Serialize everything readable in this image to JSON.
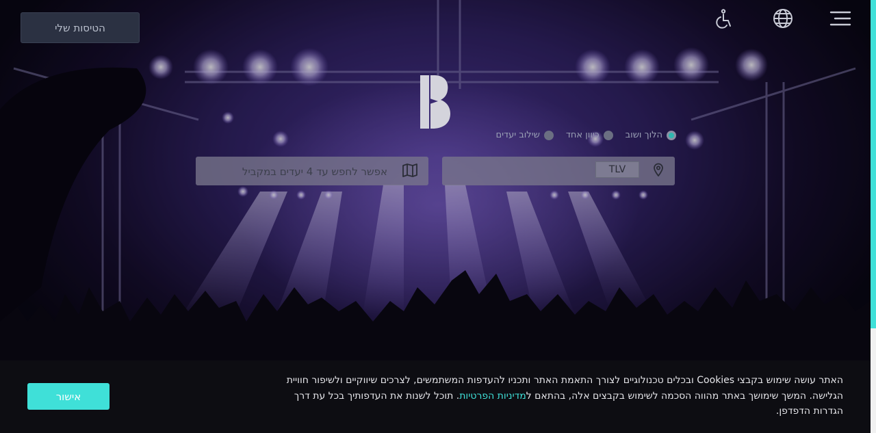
{
  "header": {
    "trips_button_label": "הטיסות שלי",
    "icons": [
      "menu-icon",
      "globe-icon",
      "accessibility-icon"
    ]
  },
  "logo": {
    "letter": "B"
  },
  "trip_types": [
    {
      "label": "הלוך ושוב",
      "selected": true
    },
    {
      "label": "כיוון אחד",
      "selected": false
    },
    {
      "label": "שילוב יעדים",
      "selected": false
    }
  ],
  "search": {
    "origin_value": "TLV",
    "destination_placeholder": "אפשר לחפש עד 4 יעדים במקביל"
  },
  "cookie_banner": {
    "text_before_link": "האתר עושה שימוש בקבצי Cookies ובכלים טכנולוגיים לצורך התאמת האתר ותכניו להעדפות המשתמשים, לצרכים שיווקיים ולשיפור חוויית הגלישה. המשך שימושך באתר מהווה הסכמה לשימוש בקבצים אלה, בהתאם ל",
    "link_text": "מדיניות הפרטיות",
    "text_after_link": ". תוכל לשנות את העדפותיך בכל עת דרך הגדרות הדפדפן.",
    "accept_label": "אישור"
  },
  "colors": {
    "accent": "#3fe0d8",
    "banner_bg": "#0d0d12",
    "trips_button_bg": "#2b3142"
  }
}
